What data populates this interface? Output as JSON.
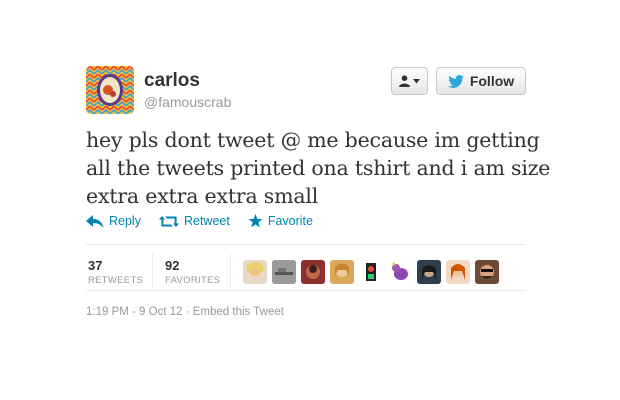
{
  "user": {
    "name": "carlos",
    "handle": "@famouscrab"
  },
  "buttons": {
    "follow_label": "Follow"
  },
  "tweet": {
    "lines": [
      "hey pls dont tweet @ me because im getting",
      "all the tweets printed ona tshirt and i am size",
      "extra extra extra small"
    ]
  },
  "actions": {
    "reply": "Reply",
    "retweet": "Retweet",
    "favorite": "Favorite"
  },
  "stats": {
    "retweets_count": "37",
    "retweets_label": "RETWEETS",
    "favorites_count": "92",
    "favorites_label": "FAVORITES"
  },
  "meta": {
    "timestamp": "1:19 PM - 9 Oct 12",
    "separator": " · ",
    "embed": "Embed this Tweet"
  },
  "colors": {
    "link": "#0084b4",
    "twitter_blue": "#2aa9e0",
    "muted": "#999999"
  }
}
